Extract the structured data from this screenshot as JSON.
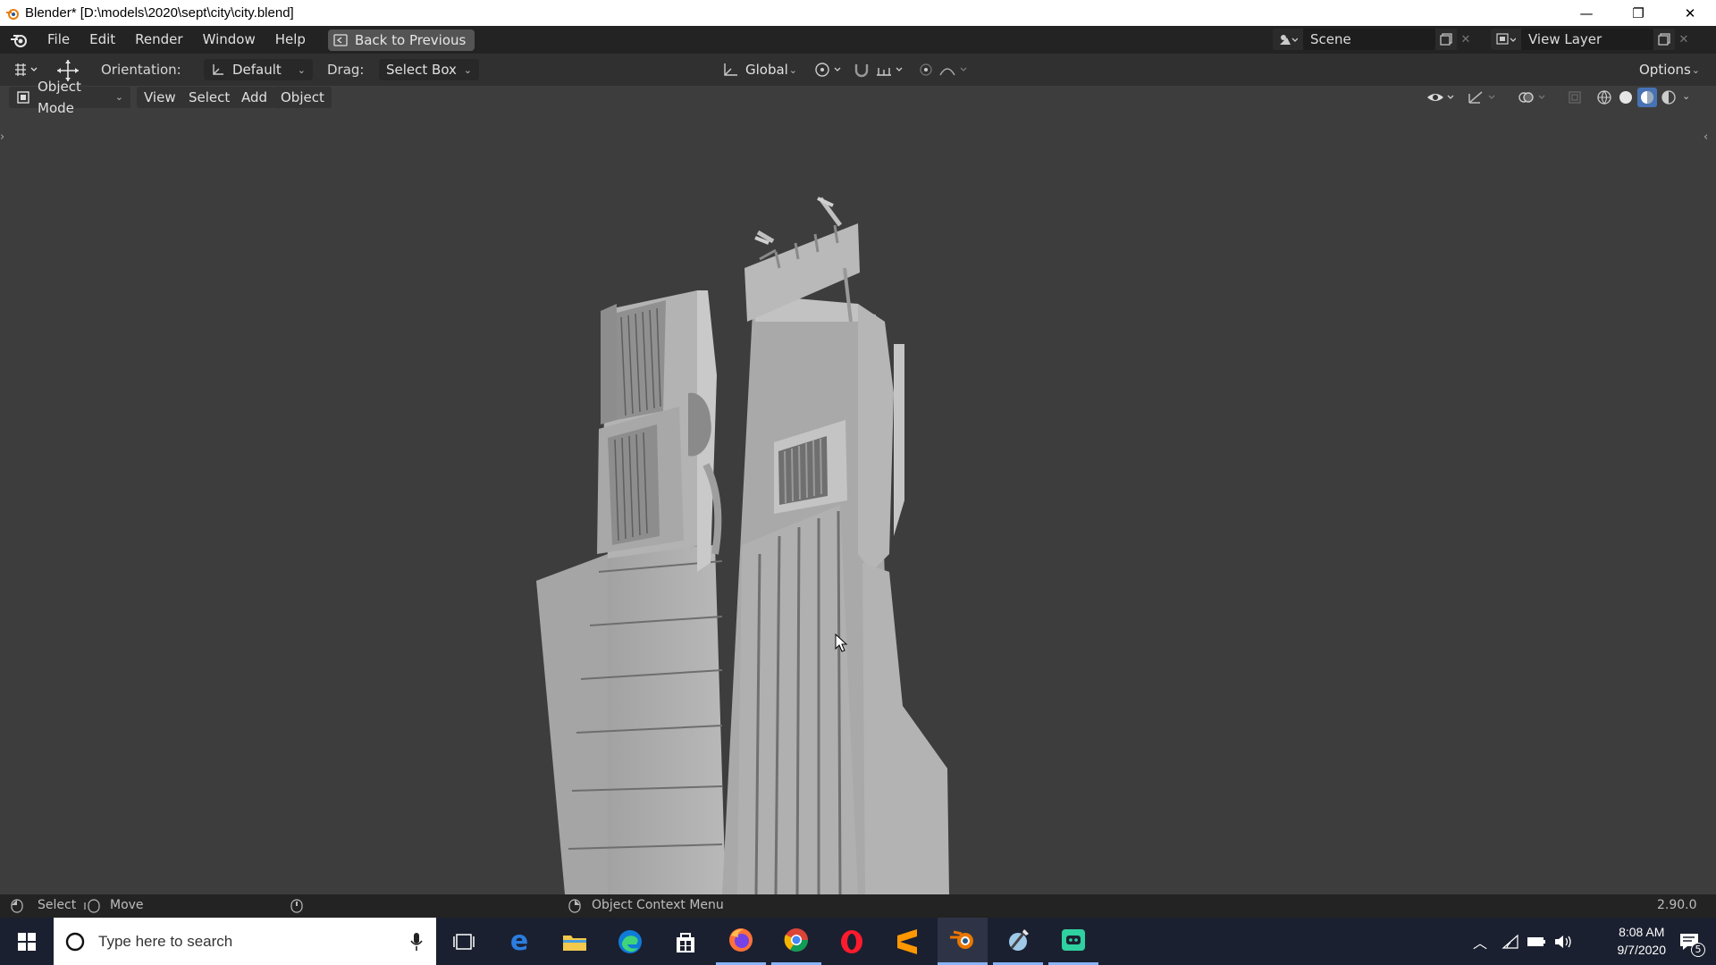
{
  "window": {
    "title": "Blender* [D:\\models\\2020\\sept\\city\\city.blend]",
    "minimize_glyph": "—",
    "maximize_glyph": "❐",
    "close_glyph": "✕"
  },
  "menubar": {
    "items": [
      "File",
      "Edit",
      "Render",
      "Window",
      "Help"
    ],
    "back_button": "Back to Previous",
    "scene": "Scene",
    "view_layer": "View Layer"
  },
  "toolheader": {
    "orientation_label": "Orientation:",
    "orientation_value": "Default",
    "drag_label": "Drag:",
    "drag_value": "Select Box",
    "transform_orientation": "Global",
    "options_label": "Options"
  },
  "viewport_header": {
    "mode": "Object Mode",
    "menus": [
      "View",
      "Select",
      "Add",
      "Object"
    ]
  },
  "statusbar": {
    "select": "Select",
    "move": "Move",
    "context_menu": "Object Context Menu",
    "version": "2.90.0"
  },
  "taskbar": {
    "search_placeholder": "Type here to search",
    "time": "8:08 AM",
    "date": "9/7/2020",
    "notification_count": "5",
    "apps": [
      "task-view",
      "edge-legacy",
      "file-explorer",
      "edge",
      "store",
      "firefox",
      "chrome",
      "opera",
      "sublime-text",
      "blender",
      "paint-tool",
      "discord-like"
    ]
  },
  "colors": {
    "accent": "#4772b3",
    "background": "#3d3d3d",
    "header": "#303030",
    "menubar": "#232323",
    "taskbar": "#1b2030"
  }
}
